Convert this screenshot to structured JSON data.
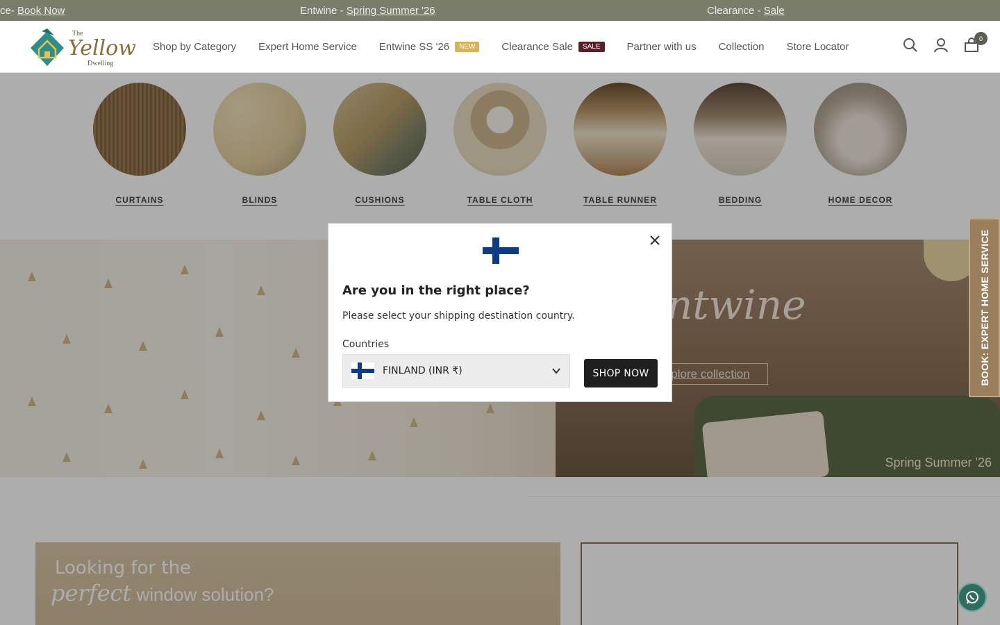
{
  "announcement": {
    "item1_prefix": "ce- ",
    "item1_link": "Book Now",
    "item2_prefix": "Entwine - ",
    "item2_link": "Spring Summer '26",
    "item3_prefix": "Clearance - ",
    "item3_link": "Sale"
  },
  "logo": {
    "the": "The",
    "yellow": "Yellow",
    "dwelling": "Dwelling"
  },
  "nav": {
    "items": [
      {
        "label": "Shop by Category"
      },
      {
        "label": "Expert Home Service"
      },
      {
        "label": "Entwine SS '26",
        "badge": "NEW"
      },
      {
        "label": "Clearance Sale",
        "badge": "SALE"
      },
      {
        "label": "Partner with us"
      },
      {
        "label": "Collection"
      },
      {
        "label": "Store Locator"
      }
    ]
  },
  "header_icons": {
    "search": "search-icon",
    "account": "account-icon",
    "cart": "cart-icon",
    "cart_count": "0"
  },
  "categories": [
    {
      "label": "CURTAINS"
    },
    {
      "label": "BLINDS"
    },
    {
      "label": "CUSHIONS"
    },
    {
      "label": "TABLE CLOTH"
    },
    {
      "label": "TABLE RUNNER"
    },
    {
      "label": "BEDDING"
    },
    {
      "label": "HOME DECOR"
    }
  ],
  "hero": {
    "title": "ntwine",
    "cta": "plore collection",
    "season": "Spring Summer '26"
  },
  "promo": {
    "line1": "Looking for the",
    "line2_script": "perfect",
    "line2_rest": " window solution?"
  },
  "side_tab": {
    "label": "BOOK: EXPERT HOME SERVICE"
  },
  "modal": {
    "title": "Are you in the right place?",
    "subtitle": "Please select your shipping destination country.",
    "countries_label": "Countries",
    "selected_country": "FINLAND (INR ₹)",
    "button": "SHOP NOW",
    "flag_icon": "finland-flag-icon"
  },
  "colors": {
    "announcement_bg": "#7a7d6a",
    "badge_new": "#d9b257",
    "badge_sale": "#5a1f28",
    "button_dark": "#1f1f1f",
    "finland_blue": "#0d3b85"
  }
}
